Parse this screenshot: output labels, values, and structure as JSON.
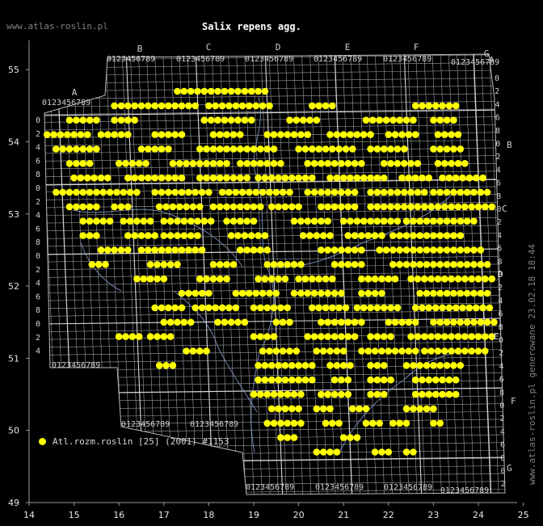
{
  "header": {
    "site": "www.atlas-roslin.pl",
    "title": "Salix repens agg."
  },
  "side_note": "www.atlas-roslin.pl generowane 23.02.18 18:44",
  "legend": {
    "label": "Atl.rozm.roslin [25] (2001) #1153",
    "dot_color": "#ffff00"
  },
  "colors": {
    "background": "#000000",
    "grid": "#b9b9b9",
    "points": "#ffff00",
    "axis_text": "#e6e6e6",
    "watermark": "#7f7f7f"
  },
  "axes": {
    "x_ticks": [
      "14",
      "15",
      "16",
      "17",
      "18",
      "19",
      "20",
      "21",
      "22",
      "23",
      "24",
      "25"
    ],
    "y_ticks": [
      "49",
      "50",
      "51",
      "52",
      "53",
      "54",
      "55"
    ]
  },
  "grid_letters": {
    "top": [
      "A",
      "B",
      "C",
      "D",
      "E",
      "F",
      "G"
    ],
    "right": [
      "A",
      "B",
      "C",
      "D",
      "E",
      "F",
      "G"
    ]
  },
  "grid_digits_row": "0123456789",
  "grid_digits_col": [
    "0",
    "2",
    "4",
    "6",
    "8"
  ],
  "map_data": {
    "projection": "lon-lat",
    "lon_range": [
      14,
      25
    ],
    "lat_range": [
      49,
      55.7
    ],
    "lat_centers": [
      54.7,
      54.5,
      54.3,
      54.1,
      53.9,
      53.7,
      53.5,
      53.3,
      53.1,
      52.9,
      52.7,
      52.5,
      52.3,
      52.1,
      51.9,
      51.7,
      51.5,
      51.3,
      51.1,
      50.9,
      50.7,
      50.5,
      50.3,
      50.1,
      49.9,
      49.7
    ],
    "rows": [
      [
        [
          17.3,
          19.3
        ]
      ],
      [
        [
          15.9,
          17.8
        ],
        [
          18.0,
          19.4
        ],
        [
          20.3,
          20.8
        ],
        [
          22.6,
          23.6
        ]
      ],
      [
        [
          14.9,
          15.5
        ],
        [
          15.9,
          16.4
        ],
        [
          17.9,
          19.0
        ],
        [
          19.8,
          20.4
        ],
        [
          21.5,
          22.6
        ],
        [
          23.0,
          23.5
        ]
      ],
      [
        [
          14.4,
          15.3
        ],
        [
          15.6,
          16.2
        ],
        [
          16.8,
          17.5
        ],
        [
          18.1,
          18.8
        ],
        [
          19.3,
          20.3
        ],
        [
          20.7,
          21.7
        ],
        [
          22.0,
          22.7
        ],
        [
          23.1,
          23.6
        ]
      ],
      [
        [
          14.6,
          15.6
        ],
        [
          16.5,
          17.2
        ],
        [
          17.8,
          19.5
        ],
        [
          20.0,
          21.2
        ],
        [
          21.6,
          22.4
        ],
        [
          23.0,
          23.6
        ]
      ],
      [
        [
          14.9,
          15.4
        ],
        [
          16.0,
          16.6
        ],
        [
          17.2,
          18.4
        ],
        [
          18.7,
          19.6
        ],
        [
          20.2,
          21.5
        ],
        [
          21.9,
          22.7
        ],
        [
          23.1,
          23.8
        ]
      ],
      [
        [
          15.0,
          15.8
        ],
        [
          16.2,
          17.4
        ],
        [
          17.8,
          18.9
        ],
        [
          19.1,
          20.3
        ],
        [
          20.7,
          21.9
        ],
        [
          22.3,
          22.9
        ],
        [
          23.2,
          24.2
        ]
      ],
      [
        [
          14.6,
          16.5
        ],
        [
          16.8,
          18.0
        ],
        [
          18.3,
          19.9
        ],
        [
          20.2,
          21.3
        ],
        [
          21.6,
          22.8
        ],
        [
          23.0,
          24.2
        ]
      ],
      [
        [
          14.9,
          15.6
        ],
        [
          15.9,
          16.3
        ],
        [
          16.9,
          17.9
        ],
        [
          18.1,
          19.2
        ],
        [
          19.4,
          20.1
        ],
        [
          20.5,
          21.3
        ],
        [
          21.6,
          22.7
        ],
        [
          22.8,
          24.3
        ]
      ],
      [
        [
          15.2,
          15.9
        ],
        [
          16.1,
          16.7
        ],
        [
          17.0,
          18.1
        ],
        [
          18.4,
          19.0
        ],
        [
          19.9,
          20.7
        ],
        [
          21.0,
          22.3
        ],
        [
          22.4,
          24.0
        ]
      ],
      [
        [
          15.2,
          15.6
        ],
        [
          16.2,
          16.8
        ],
        [
          17.0,
          17.8
        ],
        [
          18.5,
          19.3
        ],
        [
          20.1,
          20.8
        ],
        [
          21.1,
          21.9
        ],
        [
          22.1,
          23.7
        ]
      ],
      [
        [
          15.6,
          16.2
        ],
        [
          16.5,
          17.9
        ],
        [
          18.7,
          19.4
        ],
        [
          20.5,
          21.5
        ],
        [
          21.8,
          24.1
        ]
      ],
      [
        [
          15.4,
          15.8
        ],
        [
          16.7,
          17.4
        ],
        [
          18.1,
          18.6
        ],
        [
          19.3,
          20.1
        ],
        [
          20.8,
          21.4
        ],
        [
          22.1,
          24.2
        ]
      ],
      [
        [
          16.4,
          17.1
        ],
        [
          17.8,
          18.4
        ],
        [
          19.1,
          19.7
        ],
        [
          20.0,
          20.8
        ],
        [
          21.4,
          22.2
        ],
        [
          22.5,
          24.3
        ]
      ],
      [
        [
          17.4,
          18.0
        ],
        [
          18.6,
          19.5
        ],
        [
          19.9,
          21.0
        ],
        [
          21.4,
          21.9
        ],
        [
          22.7,
          24.2
        ]
      ],
      [
        [
          16.8,
          17.4
        ],
        [
          17.7,
          18.6
        ],
        [
          19.0,
          19.8
        ],
        [
          20.3,
          21.1
        ],
        [
          21.3,
          22.3
        ],
        [
          22.6,
          24.3
        ]
      ],
      [
        [
          17.0,
          17.7
        ],
        [
          18.2,
          18.9
        ],
        [
          19.5,
          19.9
        ],
        [
          20.5,
          21.4
        ],
        [
          22.0,
          22.7
        ],
        [
          23.0,
          24.4
        ]
      ],
      [
        [
          16.0,
          16.5
        ],
        [
          16.7,
          17.2
        ],
        [
          19.0,
          19.5
        ],
        [
          20.2,
          21.3
        ],
        [
          21.6,
          22.1
        ],
        [
          22.5,
          24.4
        ]
      ],
      [
        [
          17.5,
          18.0
        ],
        [
          19.2,
          20.0
        ],
        [
          20.4,
          21.1
        ],
        [
          21.4,
          22.6
        ],
        [
          22.8,
          24.2
        ]
      ],
      [
        [
          16.9,
          17.2
        ],
        [
          19.1,
          20.3
        ],
        [
          20.7,
          21.2
        ],
        [
          21.6,
          21.9
        ],
        [
          22.4,
          23.7
        ]
      ],
      [
        [
          19.1,
          20.4
        ],
        [
          20.8,
          21.1
        ],
        [
          21.6,
          22.1
        ],
        [
          22.6,
          23.5
        ]
      ],
      [
        [
          19.0,
          20.1
        ],
        [
          20.5,
          21.1
        ],
        [
          21.6,
          22.0
        ],
        [
          22.6,
          23.6
        ]
      ],
      [
        [
          19.4,
          20.1
        ],
        [
          20.4,
          20.8
        ],
        [
          21.2,
          21.6
        ],
        [
          22.4,
          23.1
        ]
      ],
      [
        [
          19.3,
          20.1
        ],
        [
          20.6,
          20.9
        ],
        [
          21.5,
          21.8
        ],
        [
          22.1,
          22.4
        ],
        [
          23.0,
          23.2
        ]
      ],
      [
        [
          19.6,
          20.0
        ],
        [
          21.0,
          21.3
        ]
      ],
      [
        [
          20.4,
          20.9
        ],
        [
          21.7,
          22.0
        ],
        [
          22.4,
          22.6
        ]
      ]
    ]
  }
}
